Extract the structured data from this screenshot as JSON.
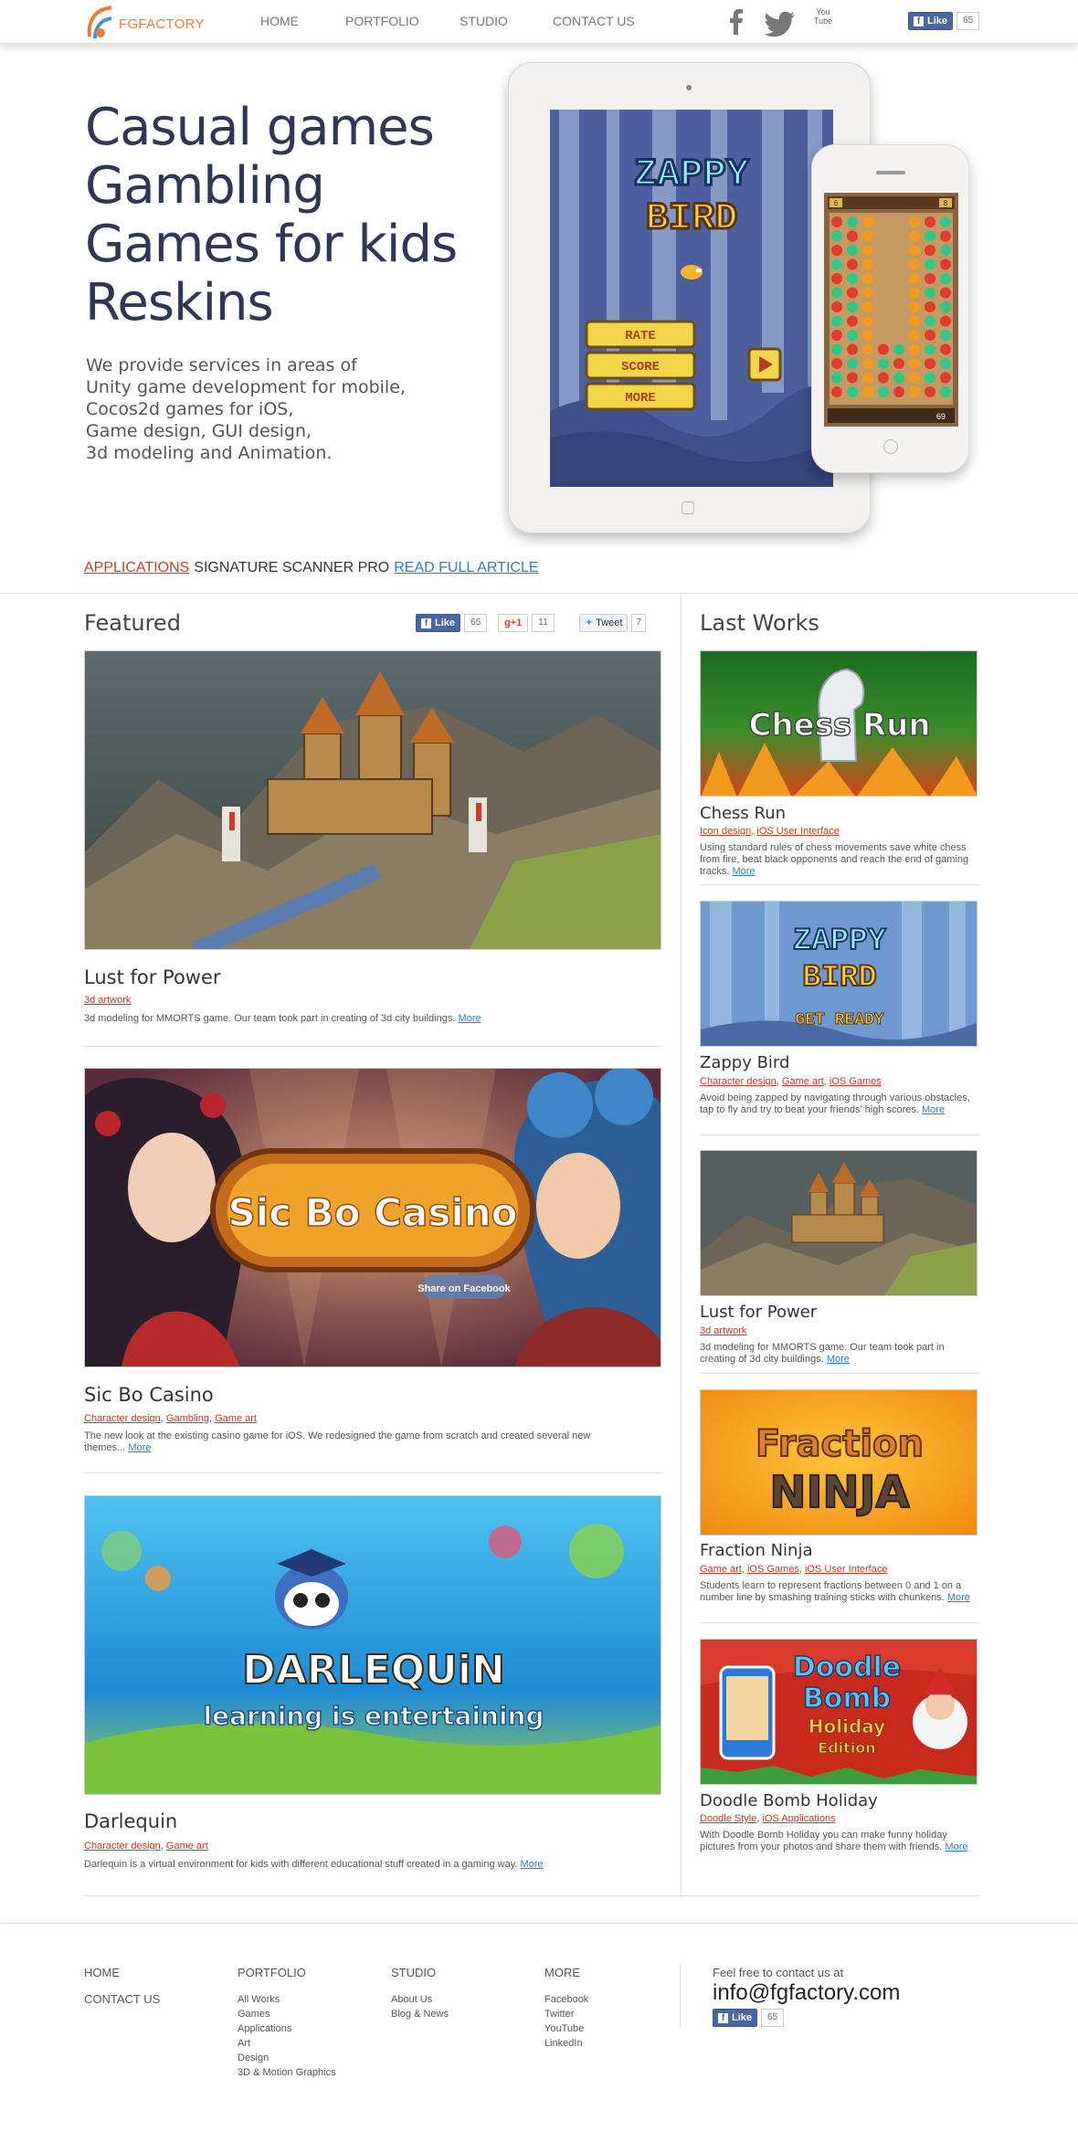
{
  "header": {
    "logo_text": "FGFACTORY",
    "nav": [
      "HOME",
      "PORTFOLIO",
      "STUDIO",
      "CONTACT US"
    ],
    "social_icons": [
      "facebook-icon",
      "twitter-icon",
      "youtube-icon"
    ],
    "youtube_label": "You Tube",
    "like_label": "Like",
    "like_count": "65"
  },
  "hero": {
    "title_lines": [
      "Casual games",
      "Gambling",
      "Games for kids",
      "Reskins"
    ],
    "desc_lines": [
      "We provide services in areas of",
      "Unity game development for mobile,",
      "Cocos2d games for iOS,",
      "Game design, GUI design,",
      "3d modeling and Animation."
    ],
    "ipad_game": {
      "title_top": "ZAPPY",
      "title_bottom": "BIRD",
      "buttons": [
        "RATE",
        "SCORE",
        "MORE"
      ]
    },
    "iphone_game": {
      "score_left": "6",
      "score_right": "8",
      "counter": "69"
    }
  },
  "ticker": {
    "category": "APPLICATIONS",
    "headline": "SIGNATURE SCANNER PRO",
    "link": "READ FULL ARTICLE"
  },
  "featured": {
    "heading": "Featured",
    "share": {
      "like_label": "Like",
      "like_count": "65",
      "gplus_label": "+1",
      "gplus_count": "11",
      "tweet_label": "Tweet",
      "tweet_count": "7"
    },
    "items": [
      {
        "title": "Lust for Power",
        "tags": [
          "3d artwork"
        ],
        "desc": "3d modeling for MMORTS game. Our team took part in creating of 3d city buildings.",
        "more": "More"
      },
      {
        "title": "Sic Bo Casino",
        "tags": [
          "Character design",
          "Gambling",
          "Game art"
        ],
        "desc": "The new look at the existing casino game for iOS. We redesigned the game from scratch and created several new themes...",
        "more": "More",
        "image_text": "Sic Bo Casino",
        "image_subtext": "Share on Facebook"
      },
      {
        "title": "Darlequin",
        "tags": [
          "Character design",
          "Game art"
        ],
        "desc": "Darlequin is a virtual environment for kids with different educational stuff created in a gaming way.",
        "more": "More",
        "image_text": "DARLEQUiN",
        "image_subtext": "learning is entertaining"
      }
    ]
  },
  "last_works": {
    "heading": "Last Works",
    "items": [
      {
        "title": "Chess Run",
        "tags": [
          "Icon design",
          "iOS User Interface"
        ],
        "desc": "Using standard rules of chess movements save white chess from fire, beat black opponents and reach the end of gaming tracks.",
        "more": "More",
        "image_text": "Chess Run"
      },
      {
        "title": "Zappy Bird",
        "tags": [
          "Character design",
          "Game art",
          "iOS Games"
        ],
        "desc": "Avoid being zapped by navigating through various obstacles, tap to fly and try to beat your friends' high scores.",
        "more": "More",
        "image_text": [
          "ZAPPY",
          "BIRD",
          "GET READY"
        ]
      },
      {
        "title": "Lust for Power",
        "tags": [
          "3d artwork"
        ],
        "desc": "3d modeling for MMORTS game. Our team took part in creating of 3d city buildings.",
        "more": "More"
      },
      {
        "title": "Fraction Ninja",
        "tags": [
          "Game art",
          "iOS Games",
          "iOS User Interface"
        ],
        "desc": "Students learn to represent fractions between 0 and 1 on a number line by smashing training sticks with chunkens.",
        "more": "More",
        "image_text": [
          "Fraction",
          "NINJA"
        ]
      },
      {
        "title": "Doodle Bomb Holiday",
        "tags": [
          "Doodle Style",
          "iOS Applications"
        ],
        "desc": "With Doodle Bomb Holiday you can make funny holiday pictures from your photos and share them with friends.",
        "more": "More",
        "image_text": [
          "Doodle",
          "Bomb",
          "Holiday",
          "Edition"
        ]
      }
    ]
  },
  "footer": {
    "col1": {
      "items": [
        "HOME",
        "CONTACT US"
      ]
    },
    "col2": {
      "heading": "PORTFOLIO",
      "items": [
        "All Works",
        "Games",
        "Applications",
        "Art",
        "Design",
        "3D & Motion Graphics"
      ]
    },
    "col3": {
      "heading": "STUDIO",
      "items": [
        "About Us",
        "Blog & News"
      ]
    },
    "col4": {
      "heading": "MORE",
      "items": [
        "Facebook",
        "Twitter",
        "YouTube",
        "LinkedIn"
      ]
    },
    "contact_label": "Feel free to contact us at",
    "email": "info@fgfactory.com",
    "like_label": "Like",
    "like_count": "65"
  }
}
